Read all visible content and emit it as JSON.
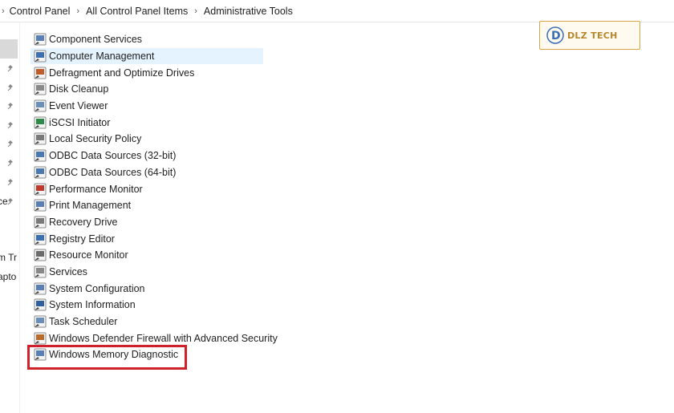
{
  "breadcrumb": {
    "items": [
      "Control Panel",
      "All Control Panel Items",
      "Administrative Tools"
    ]
  },
  "navpane": {
    "partial_texts": [
      "ce",
      "m Tr",
      "apto"
    ]
  },
  "tools": [
    {
      "label": "Component Services",
      "icon": "component-services-icon"
    },
    {
      "label": "Computer Management",
      "icon": "computer-management-icon"
    },
    {
      "label": "Defragment and Optimize Drives",
      "icon": "defragment-icon"
    },
    {
      "label": "Disk Cleanup",
      "icon": "disk-cleanup-icon"
    },
    {
      "label": "Event Viewer",
      "icon": "event-viewer-icon"
    },
    {
      "label": "iSCSI Initiator",
      "icon": "iscsi-initiator-icon"
    },
    {
      "label": "Local Security Policy",
      "icon": "local-security-policy-icon"
    },
    {
      "label": "ODBC Data Sources (32-bit)",
      "icon": "odbc-icon"
    },
    {
      "label": "ODBC Data Sources (64-bit)",
      "icon": "odbc-icon"
    },
    {
      "label": "Performance Monitor",
      "icon": "performance-monitor-icon"
    },
    {
      "label": "Print Management",
      "icon": "print-management-icon"
    },
    {
      "label": "Recovery Drive",
      "icon": "recovery-drive-icon"
    },
    {
      "label": "Registry Editor",
      "icon": "registry-editor-icon"
    },
    {
      "label": "Resource Monitor",
      "icon": "resource-monitor-icon"
    },
    {
      "label": "Services",
      "icon": "services-icon"
    },
    {
      "label": "System Configuration",
      "icon": "system-configuration-icon"
    },
    {
      "label": "System Information",
      "icon": "system-information-icon"
    },
    {
      "label": "Task Scheduler",
      "icon": "task-scheduler-icon"
    },
    {
      "label": "Windows Defender Firewall with Advanced Security",
      "icon": "firewall-icon"
    },
    {
      "label": "Windows Memory Diagnostic",
      "icon": "memory-diagnostic-icon"
    }
  ],
  "selected_index": 1,
  "highlighted_index": 19,
  "colors": {
    "selection": "#e5f3ff",
    "highlight_border": "#d0212a",
    "logo": "#b8862a"
  },
  "logo": {
    "text": "DLZ TECH",
    "letter": "D"
  }
}
